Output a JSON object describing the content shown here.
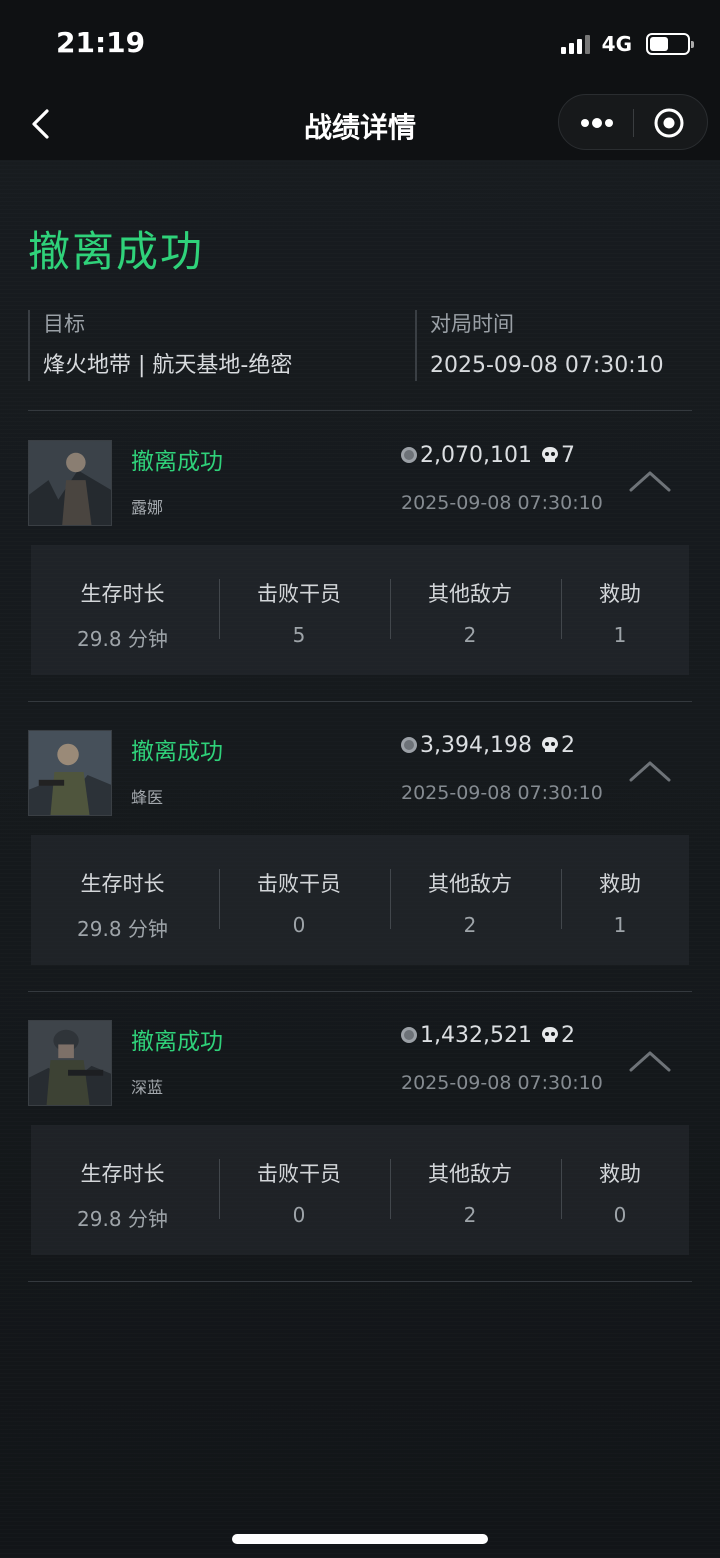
{
  "status_bar": {
    "time": "21:19",
    "network": "4G"
  },
  "nav": {
    "title": "战绩详情"
  },
  "header": {
    "result": "撤离成功",
    "target_label": "目标",
    "target_value": "烽火地带 | 航天基地-绝密",
    "time_label": "对局时间",
    "time_value": "2025-09-08 07:30:10"
  },
  "stat_labels": {
    "survival": "生存时长",
    "operators_defeated": "击败干员",
    "other_enemies": "其他敌方",
    "assists": "救助"
  },
  "players": [
    {
      "status": "撤离成功",
      "name": "露娜",
      "value": "2,070,101",
      "kills": "7",
      "time": "2025-09-08 07:30:10",
      "survival": "29.8 分钟",
      "operators_defeated": "5",
      "other_enemies": "2",
      "assists": "1"
    },
    {
      "status": "撤离成功",
      "name": "蜂医",
      "value": "3,394,198",
      "kills": "2",
      "time": "2025-09-08 07:30:10",
      "survival": "29.8 分钟",
      "operators_defeated": "0",
      "other_enemies": "2",
      "assists": "1"
    },
    {
      "status": "撤离成功",
      "name": "深蓝",
      "value": "1,432,521",
      "kills": "2",
      "time": "2025-09-08 07:30:10",
      "survival": "29.8 分钟",
      "operators_defeated": "0",
      "other_enemies": "2",
      "assists": "0"
    }
  ],
  "colors": {
    "accent_green": "#2fd27a",
    "background": "#15191c",
    "panel": "#282c31"
  }
}
